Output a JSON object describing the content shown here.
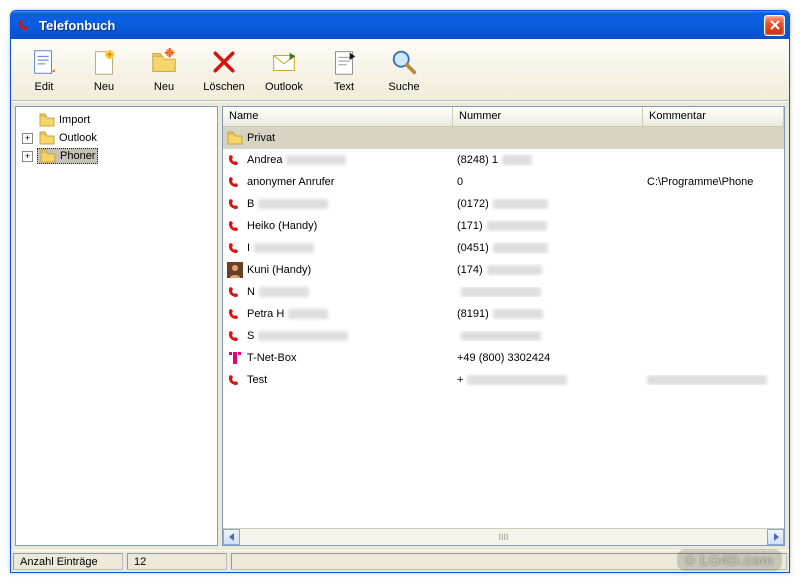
{
  "window": {
    "title": "Telefonbuch",
    "close_label": "×"
  },
  "toolbar": {
    "edit": "Edit",
    "neu1": "Neu",
    "neu2": "Neu",
    "loeschen": "Löschen",
    "outlook": "Outlook",
    "text": "Text",
    "suche": "Suche"
  },
  "tree": {
    "items": [
      {
        "label": "Import",
        "expandable": false
      },
      {
        "label": "Outlook",
        "expandable": true
      },
      {
        "label": "Phoner",
        "expandable": true,
        "selected": true
      }
    ]
  },
  "list": {
    "columns": {
      "name": "Name",
      "number": "Nummer",
      "comment": "Kommentar"
    },
    "group": "Privat",
    "rows": [
      {
        "icon": "phone",
        "name_prefix": "Andrea",
        "name_blur": 60,
        "number_prefix": "(8248) 1",
        "number_blur": 30,
        "comment": ""
      },
      {
        "icon": "phone",
        "name_prefix": "anonymer Anrufer",
        "name_blur": 0,
        "number_prefix": "0",
        "number_blur": 0,
        "comment": "C:\\Programme\\Phone"
      },
      {
        "icon": "phone",
        "name_prefix": "B",
        "name_blur": 70,
        "number_prefix": "(0172)",
        "number_blur": 55,
        "comment": ""
      },
      {
        "icon": "phone",
        "name_prefix": "Heiko (Handy)",
        "name_blur": 0,
        "number_prefix": "(171)",
        "number_blur": 60,
        "comment": ""
      },
      {
        "icon": "phone",
        "name_prefix": "I",
        "name_blur": 60,
        "number_prefix": "(0451)",
        "number_blur": 55,
        "comment": ""
      },
      {
        "icon": "avatar",
        "name_prefix": "Kuni (Handy)",
        "name_blur": 0,
        "number_prefix": "(174)",
        "number_blur": 55,
        "comment": ""
      },
      {
        "icon": "phone",
        "name_prefix": "N",
        "name_blur": 50,
        "number_prefix": "",
        "number_blur": 80,
        "comment": ""
      },
      {
        "icon": "phone",
        "name_prefix": "Petra H",
        "name_blur": 40,
        "number_prefix": "(8191)",
        "number_blur": 50,
        "comment": ""
      },
      {
        "icon": "phone",
        "name_prefix": "S",
        "name_blur": 90,
        "number_prefix": "",
        "number_blur": 80,
        "comment": ""
      },
      {
        "icon": "tnet",
        "name_prefix": "T-Net-Box",
        "name_blur": 0,
        "number_prefix": "+49 (800) 3302424",
        "number_blur": 0,
        "comment": ""
      },
      {
        "icon": "phone",
        "name_prefix": "Test",
        "name_blur": 0,
        "number_prefix": "+",
        "number_blur": 100,
        "comment_blur": 120
      }
    ]
  },
  "status": {
    "label": "Anzahl Einträge",
    "value": "12"
  },
  "watermark": "© LO4D.com"
}
